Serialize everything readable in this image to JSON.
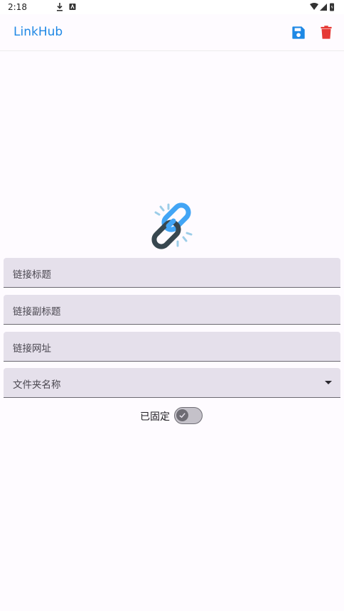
{
  "status_bar": {
    "time": "2:18"
  },
  "app_bar": {
    "title": "LinkHub"
  },
  "colors": {
    "accent": "#1e88e5",
    "delete": "#e53935",
    "field_bg": "#e5e0eb"
  },
  "form": {
    "title_label": "链接标题",
    "subtitle_label": "链接副标题",
    "url_label": "链接网址",
    "folder_label": "文件夹名称",
    "pin_label": "已固定",
    "pin_enabled": false
  }
}
